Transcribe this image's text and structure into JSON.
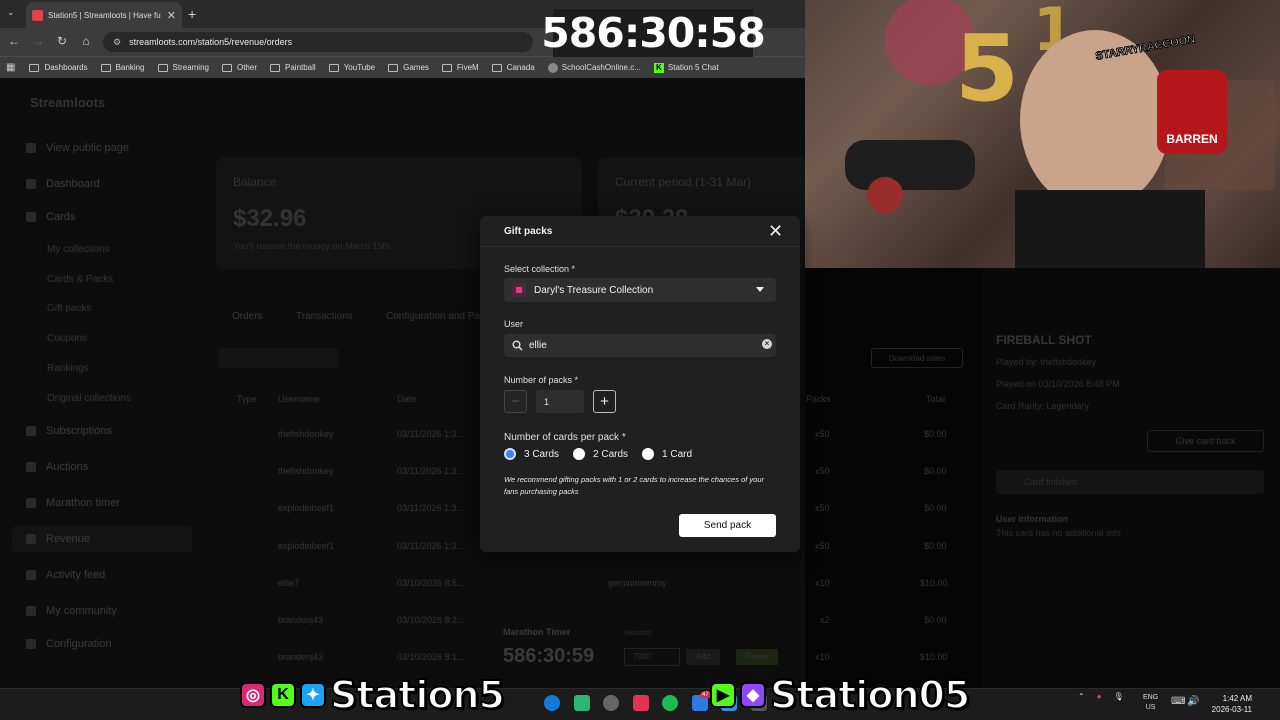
{
  "browser": {
    "tab_title": "Station5 | Streamloots | Have fu",
    "url": "streamloots.com/station5/revenue/orders",
    "bookmarks": [
      "Dashboards",
      "Banking",
      "Streaming",
      "Other",
      "Paintball",
      "YouTube",
      "Games",
      "FiveM",
      "Canada",
      "SchoolCashOnline.c...",
      "Station 5 Chat"
    ]
  },
  "timer": "586:30:58",
  "background": {
    "brand": "Streamloots",
    "sidebar": [
      "View public page",
      "Dashboard",
      "Cards",
      "My collections",
      "Cards & Packs",
      "Gift packs",
      "Coupons",
      "Rankings",
      "Original collections",
      "Subscriptions",
      "Auctions",
      "Marathon timer",
      "Revenue",
      "Activity feed",
      "My community",
      "Configuration"
    ],
    "balance_label": "Balance",
    "balance_value": "$32.96",
    "balance_note": "You'll receive the money on March 15th",
    "period_label": "Current period (1-31 Mar)",
    "period_value": "$30.28",
    "tabs": [
      "Orders",
      "Transactions",
      "Configuration and Pa"
    ],
    "download": "Download sales",
    "columns": [
      "Type",
      "Username",
      "Date",
      "Packs",
      "Total"
    ],
    "rows": [
      {
        "user": "thefishdonkey",
        "date": "03/11/2026 1:3...",
        "packs": "x50",
        "total": "$0.00"
      },
      {
        "user": "thefishdonkey",
        "date": "03/11/2026 1:3...",
        "packs": "x50",
        "total": "$0.00"
      },
      {
        "user": "explodinbeef1",
        "date": "03/11/2026 1:3...",
        "packs": "x50",
        "total": "$0.00"
      },
      {
        "user": "explodinbeef1",
        "date": "03/11/2026 1:3...",
        "packs": "x50",
        "total": "$0.00"
      },
      {
        "user": "ellie7",
        "date": "03/10/2026 8:5...",
        "packs": "x10",
        "total": "$10.00"
      },
      {
        "user": "brandenj43",
        "date": "03/10/2026 8:2...",
        "packs": "x2",
        "total": "$0.00"
      },
      {
        "user": "brandenj43",
        "date": "03/10/2026 8:1...",
        "packs": "x10",
        "total": "$10.00"
      }
    ],
    "row5_extra": "geminimommy",
    "marathon_label": "Marathon Timer",
    "marathon_value": "586:30:59",
    "seconds_label": "Seconds",
    "seconds_value": "7000",
    "add_btn": "Add",
    "pause_btn": "Pause",
    "right_title": "FIREBALL SHOT",
    "right_played_by": "Played by: thefishdonkey",
    "right_played_on": "Played on 03/10/2026 8:48 PM",
    "right_rarity": "Card Rarity: Legendary",
    "right_give": "Give card back",
    "right_finished": "Card finished",
    "right_userinfo": "User information",
    "right_noinfo": "This card has no additional info"
  },
  "modal": {
    "title": "Gift packs",
    "collection_label": "Select collection *",
    "collection_value": "Daryl's Treasure Collection",
    "user_label": "User",
    "user_value": "ellie",
    "packs_label": "Number of packs *",
    "packs_value": "1",
    "cards_label": "Number of cards per pack *",
    "options": [
      "3 Cards",
      "2 Cards",
      "1 Card"
    ],
    "selected_option": "3 Cards",
    "hint": "We recommend gifting packs with 1 or 2 cards to increase the chances of your fans purchasing packs",
    "send": "Send pack"
  },
  "overlay": {
    "handle_left": "Station5",
    "handle_right": "Station05"
  },
  "taskbar": {
    "lang1": "ENG",
    "lang2": "US",
    "time": "1:42 AM",
    "date": "2026-03-11",
    "badge": "47"
  }
}
